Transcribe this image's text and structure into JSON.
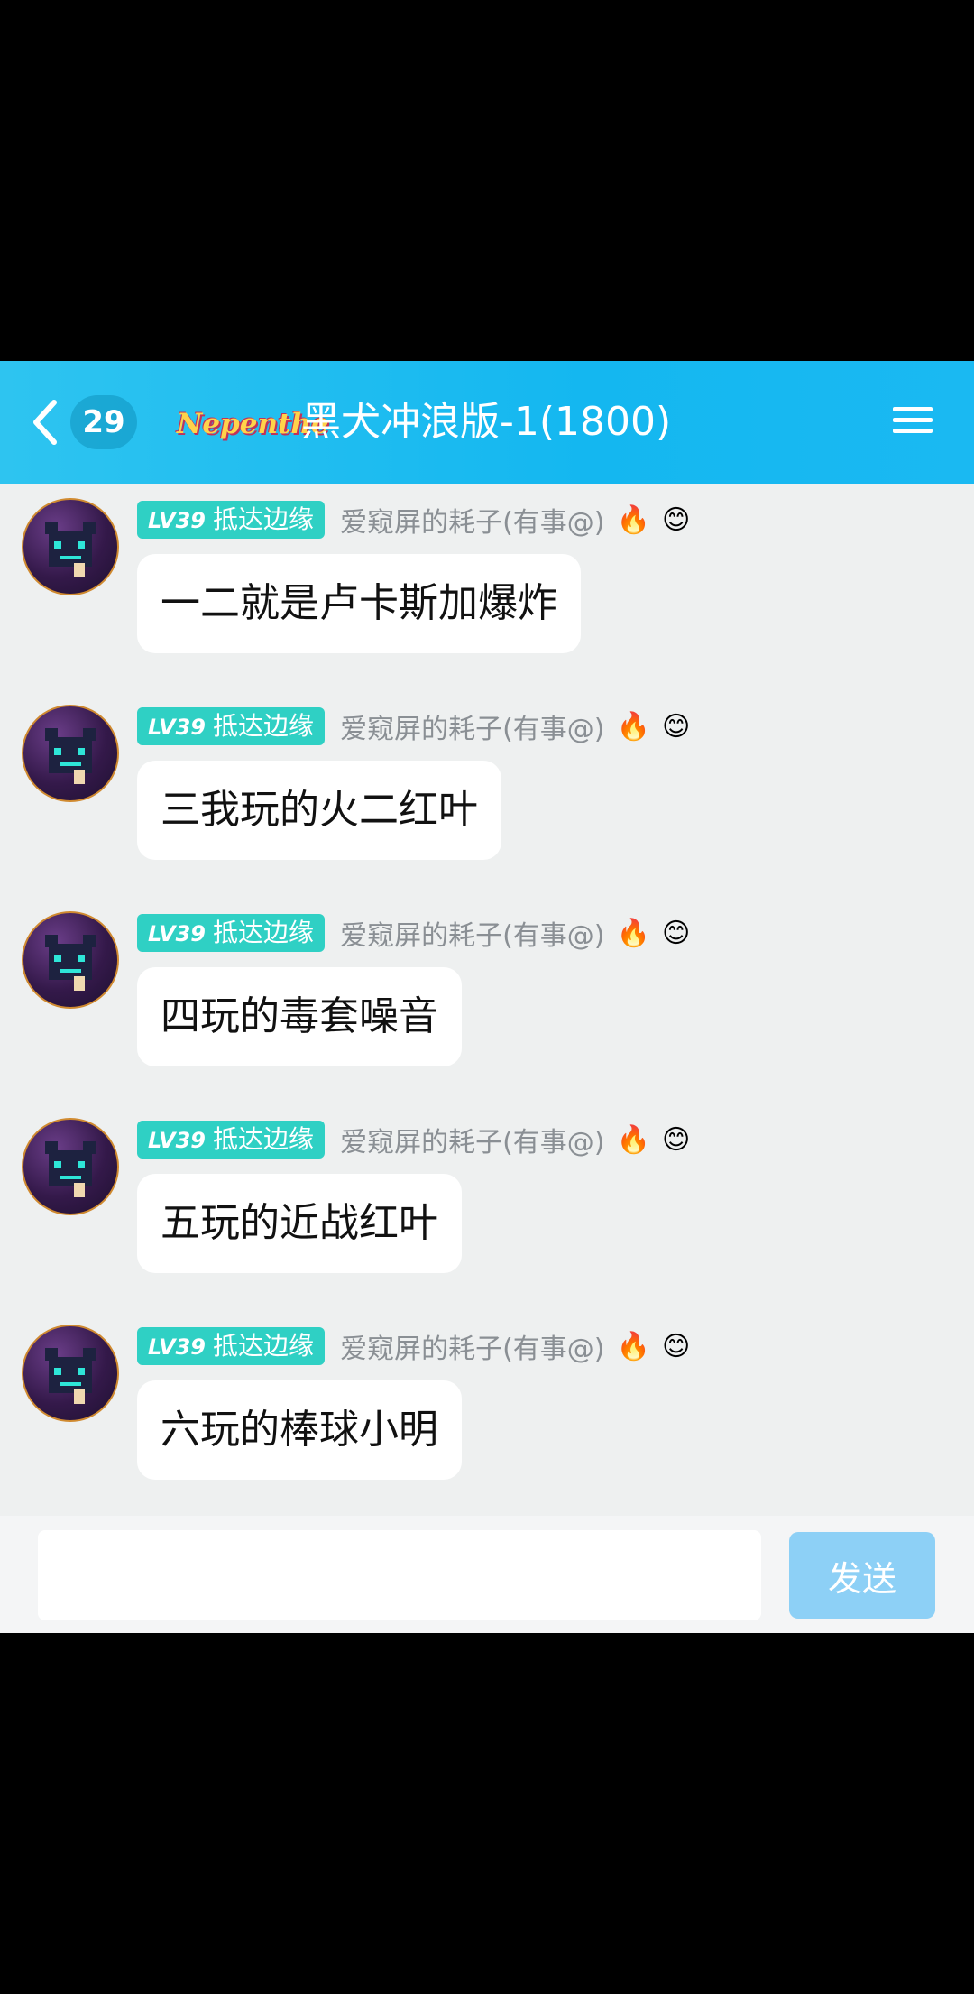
{
  "header": {
    "unread_count": "29",
    "logo_text": "Nepenthe",
    "title": "黑犬冲浪版-1(1800)"
  },
  "messages": [
    {
      "level": "LV39",
      "tag": "抵达边缘",
      "nickname": "爱窥屏的耗子(有事@)",
      "emojis": [
        "fire",
        "smiley-flower"
      ],
      "text": "一二就是卢卡斯加爆炸"
    },
    {
      "level": "LV39",
      "tag": "抵达边缘",
      "nickname": "爱窥屏的耗子(有事@)",
      "emojis": [
        "fire",
        "smiley-flower"
      ],
      "text": "三我玩的火二红叶"
    },
    {
      "level": "LV39",
      "tag": "抵达边缘",
      "nickname": "爱窥屏的耗子(有事@)",
      "emojis": [
        "fire",
        "smiley-flower"
      ],
      "text": "四玩的毒套噪音"
    },
    {
      "level": "LV39",
      "tag": "抵达边缘",
      "nickname": "爱窥屏的耗子(有事@)",
      "emojis": [
        "fire",
        "smiley-flower"
      ],
      "text": "五玩的近战红叶"
    },
    {
      "level": "LV39",
      "tag": "抵达边缘",
      "nickname": "爱窥屏的耗子(有事@)",
      "emojis": [
        "fire",
        "smiley-flower"
      ],
      "text": "六玩的棒球小明"
    }
  ],
  "input": {
    "value": "",
    "send_label": "发送"
  },
  "colors": {
    "header": "#1ab9f2",
    "level_tag": "#2fd0c4",
    "send_button": "#8dd0f6",
    "chat_background": "#eef0f0"
  }
}
